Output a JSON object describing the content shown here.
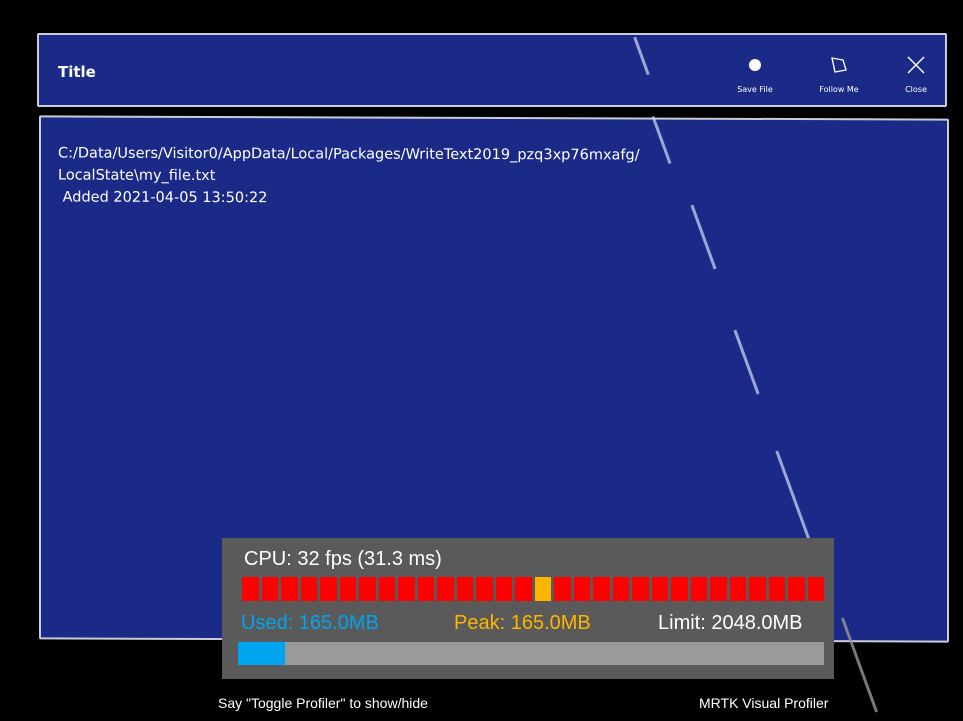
{
  "window": {
    "title": "Title",
    "buttons": [
      {
        "label": "Save File",
        "icon": "circle-icon"
      },
      {
        "label": "Follow Me",
        "icon": "pin-icon"
      },
      {
        "label": "Close",
        "icon": "close-icon"
      }
    ]
  },
  "content": {
    "path_line1": "C:/Data/Users/Visitor0/AppData/Local/Packages/WriteText2019_pzq3xp76mxafg/",
    "path_line2": "LocalState\\my_file.txt",
    "added_line": " Added 2021-04-05 13:50:22"
  },
  "profiler": {
    "cpu_text": "CPU: 32 fps (31.3 ms)",
    "used_text": "Used: 165.0MB",
    "peak_text": "Peak: 165.0MB",
    "limit_text": "Limit: 2048.0MB",
    "frame_count": 30,
    "warn_frame_index": 15,
    "memory_used_fraction": 0.08,
    "colors": {
      "used": "#00a4ef",
      "peak": "#ffb400",
      "frame_bad": "#ff0000",
      "frame_warn": "#ffb400"
    }
  },
  "footer": {
    "hint": "Say \"Toggle Profiler\" to show/hide",
    "brand": "MRTK Visual Profiler"
  }
}
